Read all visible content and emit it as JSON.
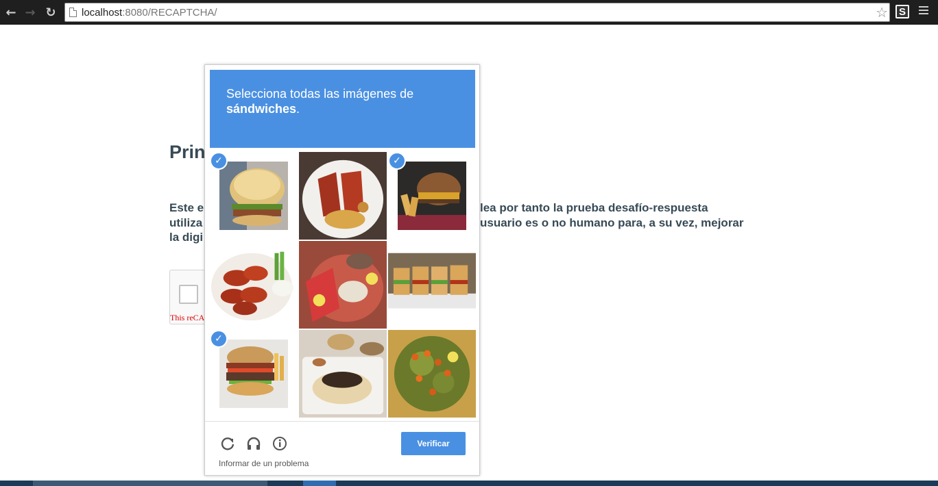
{
  "browser": {
    "url_host": "localhost",
    "url_rest": ":8080/RECAPTCHA/",
    "extension_label": "S"
  },
  "page": {
    "heading": "Prin",
    "para_lines": [
      {
        "left": "Este e",
        "right": "lea por tanto la prueba desafío-respuesta"
      },
      {
        "left": "utiliza",
        "right": "usuario es o no humano para, a su vez, mejorar"
      },
      {
        "left": "la digi",
        "right": ""
      }
    ],
    "widget_note": "This reCA"
  },
  "captcha": {
    "instruction": "Selecciona todas las imágenes de",
    "target": "sándwiches",
    "target_suffix": ".",
    "tiles": [
      {
        "name": "burger",
        "selected": true
      },
      {
        "name": "ribs-plate",
        "selected": false
      },
      {
        "name": "burger-fries",
        "selected": true
      },
      {
        "name": "chicken-wings",
        "selected": false
      },
      {
        "name": "seafood-platter",
        "selected": false
      },
      {
        "name": "sliders",
        "selected": false
      },
      {
        "name": "bacon-burger",
        "selected": true
      },
      {
        "name": "rice-plate",
        "selected": false
      },
      {
        "name": "salad",
        "selected": false
      }
    ],
    "verify_label": "Verificar",
    "report_label": "Informar de un problema"
  }
}
